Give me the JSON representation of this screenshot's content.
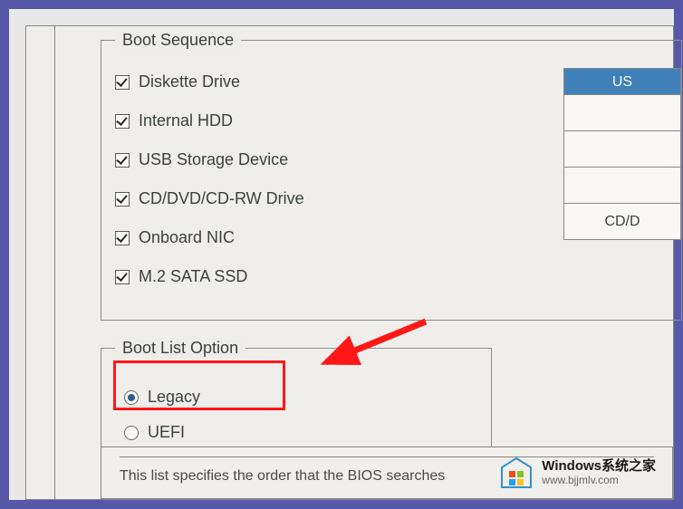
{
  "boot_sequence": {
    "legend": "Boot Sequence",
    "items": [
      {
        "label": "Diskette Drive",
        "checked": true
      },
      {
        "label": "Internal HDD",
        "checked": true
      },
      {
        "label": "USB Storage Device",
        "checked": true
      },
      {
        "label": "CD/DVD/CD-RW Drive",
        "checked": true
      },
      {
        "label": "Onboard NIC",
        "checked": true
      },
      {
        "label": "M.2 SATA SSD",
        "checked": true
      }
    ]
  },
  "side_table": {
    "header": "US",
    "rows": [
      "",
      "",
      "",
      "CD/D"
    ]
  },
  "boot_list_option": {
    "legend": "Boot List Option",
    "options": [
      {
        "label": "Legacy",
        "selected": true
      },
      {
        "label": "UEFI",
        "selected": false
      }
    ]
  },
  "description": "This list specifies the order that the BIOS searches",
  "watermark": {
    "main": "Windows系统之家",
    "sub": "www.bjjmlv.com"
  }
}
